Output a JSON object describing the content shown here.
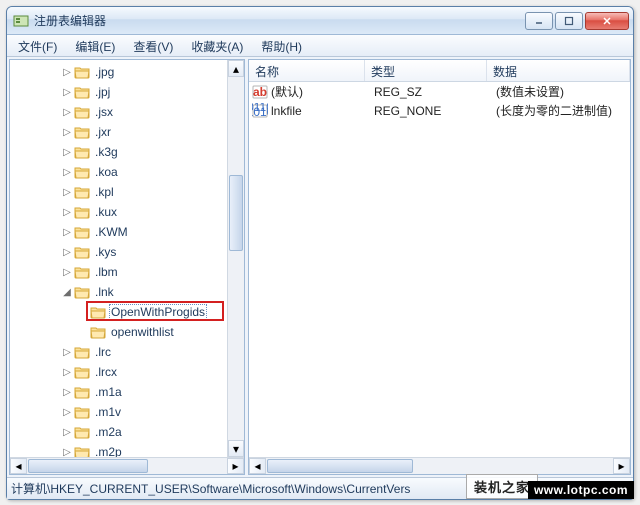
{
  "window": {
    "title": "注册表编辑器"
  },
  "menu": {
    "file": "文件(F)",
    "edit": "编辑(E)",
    "view": "查看(V)",
    "favorites": "收藏夹(A)",
    "help": "帮助(H)"
  },
  "tree": {
    "items": [
      {
        "indent": 3,
        "expander": "▷",
        "label": ".jpg"
      },
      {
        "indent": 3,
        "expander": "▷",
        "label": ".jpj"
      },
      {
        "indent": 3,
        "expander": "▷",
        "label": ".jsx"
      },
      {
        "indent": 3,
        "expander": "▷",
        "label": ".jxr"
      },
      {
        "indent": 3,
        "expander": "▷",
        "label": ".k3g"
      },
      {
        "indent": 3,
        "expander": "▷",
        "label": ".koa"
      },
      {
        "indent": 3,
        "expander": "▷",
        "label": ".kpl"
      },
      {
        "indent": 3,
        "expander": "▷",
        "label": ".kux"
      },
      {
        "indent": 3,
        "expander": "▷",
        "label": ".KWM"
      },
      {
        "indent": 3,
        "expander": "▷",
        "label": ".kys"
      },
      {
        "indent": 3,
        "expander": "▷",
        "label": ".lbm"
      },
      {
        "indent": 3,
        "expander": "◢",
        "label": ".lnk"
      },
      {
        "indent": 4,
        "expander": "",
        "label": "OpenWithProgids",
        "selected": true,
        "highlight": true
      },
      {
        "indent": 4,
        "expander": "",
        "label": "openwithlist"
      },
      {
        "indent": 3,
        "expander": "▷",
        "label": ".lrc"
      },
      {
        "indent": 3,
        "expander": "▷",
        "label": ".lrcx"
      },
      {
        "indent": 3,
        "expander": "▷",
        "label": ".m1a"
      },
      {
        "indent": 3,
        "expander": "▷",
        "label": ".m1v"
      },
      {
        "indent": 3,
        "expander": "▷",
        "label": ".m2a"
      },
      {
        "indent": 3,
        "expander": "▷",
        "label": ".m2p"
      }
    ]
  },
  "columns": {
    "name": "名称",
    "type": "类型",
    "data": "数据"
  },
  "values": [
    {
      "icon": "string",
      "name": "(默认)",
      "type": "REG_SZ",
      "data": "(数值未设置)"
    },
    {
      "icon": "binary",
      "name": "lnkfile",
      "type": "REG_NONE",
      "data": "(长度为零的二进制值)"
    }
  ],
  "statusbar": {
    "path": "计算机\\HKEY_CURRENT_USER\\Software\\Microsoft\\Windows\\CurrentVers"
  },
  "watermark": {
    "site1": "装机之家",
    "site2": "www.lotpc.com"
  },
  "colors": {
    "highlight": "#d42020"
  }
}
